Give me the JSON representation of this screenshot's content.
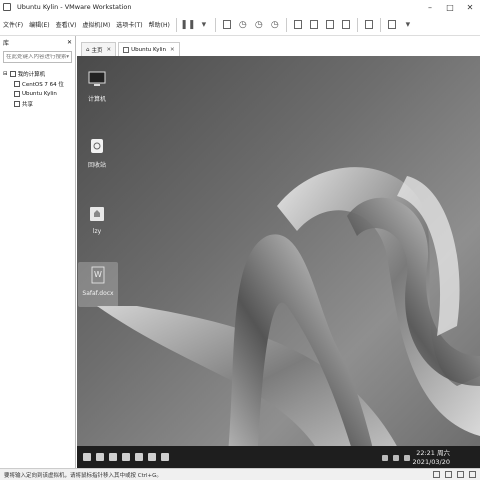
{
  "window": {
    "title": "Ubuntu Kylin - VMware Workstation"
  },
  "menu": {
    "items": [
      "文件(F)",
      "编辑(E)",
      "查看(V)",
      "虚拟机(M)",
      "选项卡(T)",
      "帮助(H)"
    ]
  },
  "library": {
    "title": "库",
    "search_placeholder": "在此处键入内容进行搜索",
    "tree": [
      {
        "label": "我的计算机"
      },
      {
        "label": "CentOS 7 64 位"
      },
      {
        "label": "Ubuntu Kylin"
      },
      {
        "label": "共享"
      }
    ]
  },
  "tabs": [
    {
      "label": "主页"
    },
    {
      "label": "Ubuntu Kylin"
    }
  ],
  "desktop": {
    "icons": [
      {
        "label": "计算机"
      },
      {
        "label": "回收站"
      },
      {
        "label": "lzy"
      },
      {
        "label": "Safaf.docx"
      }
    ],
    "clock_time": "22:21 周六",
    "clock_date": "2021/03/20"
  },
  "statusbar": {
    "text": "要将输入定向到该虚拟机，请将鼠标指针移入其中或按 Ctrl+G。"
  }
}
